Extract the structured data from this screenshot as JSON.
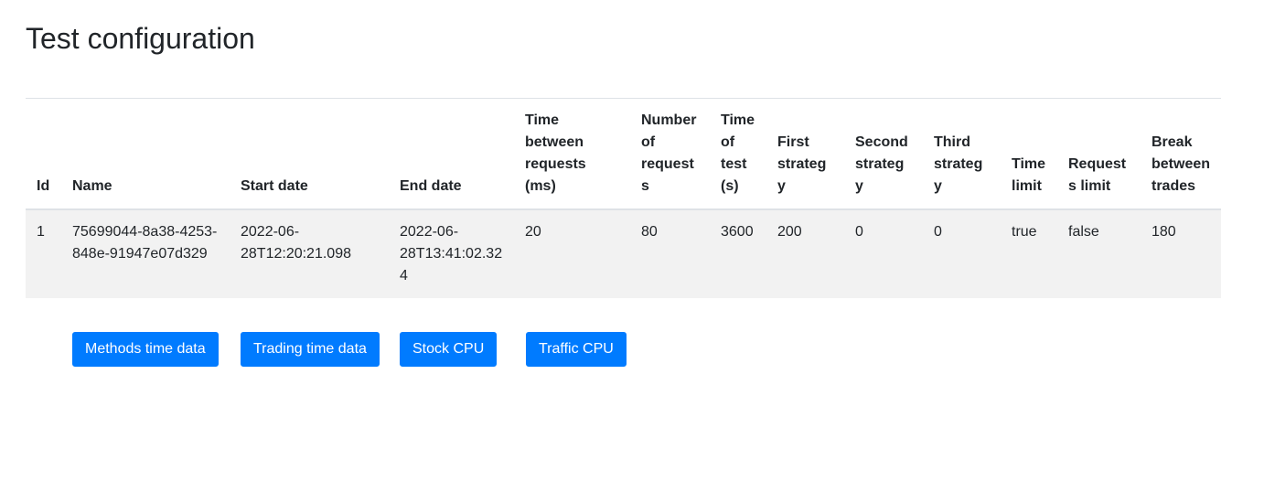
{
  "page": {
    "title": "Test configuration"
  },
  "table": {
    "headers": {
      "id": "Id",
      "name": "Name",
      "start_date": "Start date",
      "end_date": "End date",
      "time_between_requests": "Time between requests (ms)",
      "number_of_requests": "Number of requests",
      "time_of_test": "Time of test (s)",
      "first_strategy": "First strategy",
      "second_strategy": "Second strategy",
      "third_strategy": "Third strategy",
      "time_limit": "Time limit",
      "requests_limit": "Requests limit",
      "break_between_trades": "Break between trades"
    },
    "rows": [
      {
        "id": "1",
        "name": "75699044-8a38-4253-848e-91947e07d329",
        "start_date": "2022-06-28T12:20:21.098",
        "end_date": "2022-06-28T13:41:02.324",
        "time_between_requests": "20",
        "number_of_requests": "80",
        "time_of_test": "3600",
        "first_strategy": "200",
        "second_strategy": "0",
        "third_strategy": "0",
        "time_limit": "true",
        "requests_limit": "false",
        "break_between_trades": "180"
      }
    ]
  },
  "buttons": {
    "methods_time_data": "Methods time data",
    "trading_time_data": "Trading time data",
    "stock_cpu": "Stock CPU",
    "traffic_cpu": "Traffic CPU"
  },
  "colors": {
    "primary_button": "#007bff",
    "row_background": "#f2f2f2",
    "text": "#212529",
    "border": "#dee2e6"
  }
}
